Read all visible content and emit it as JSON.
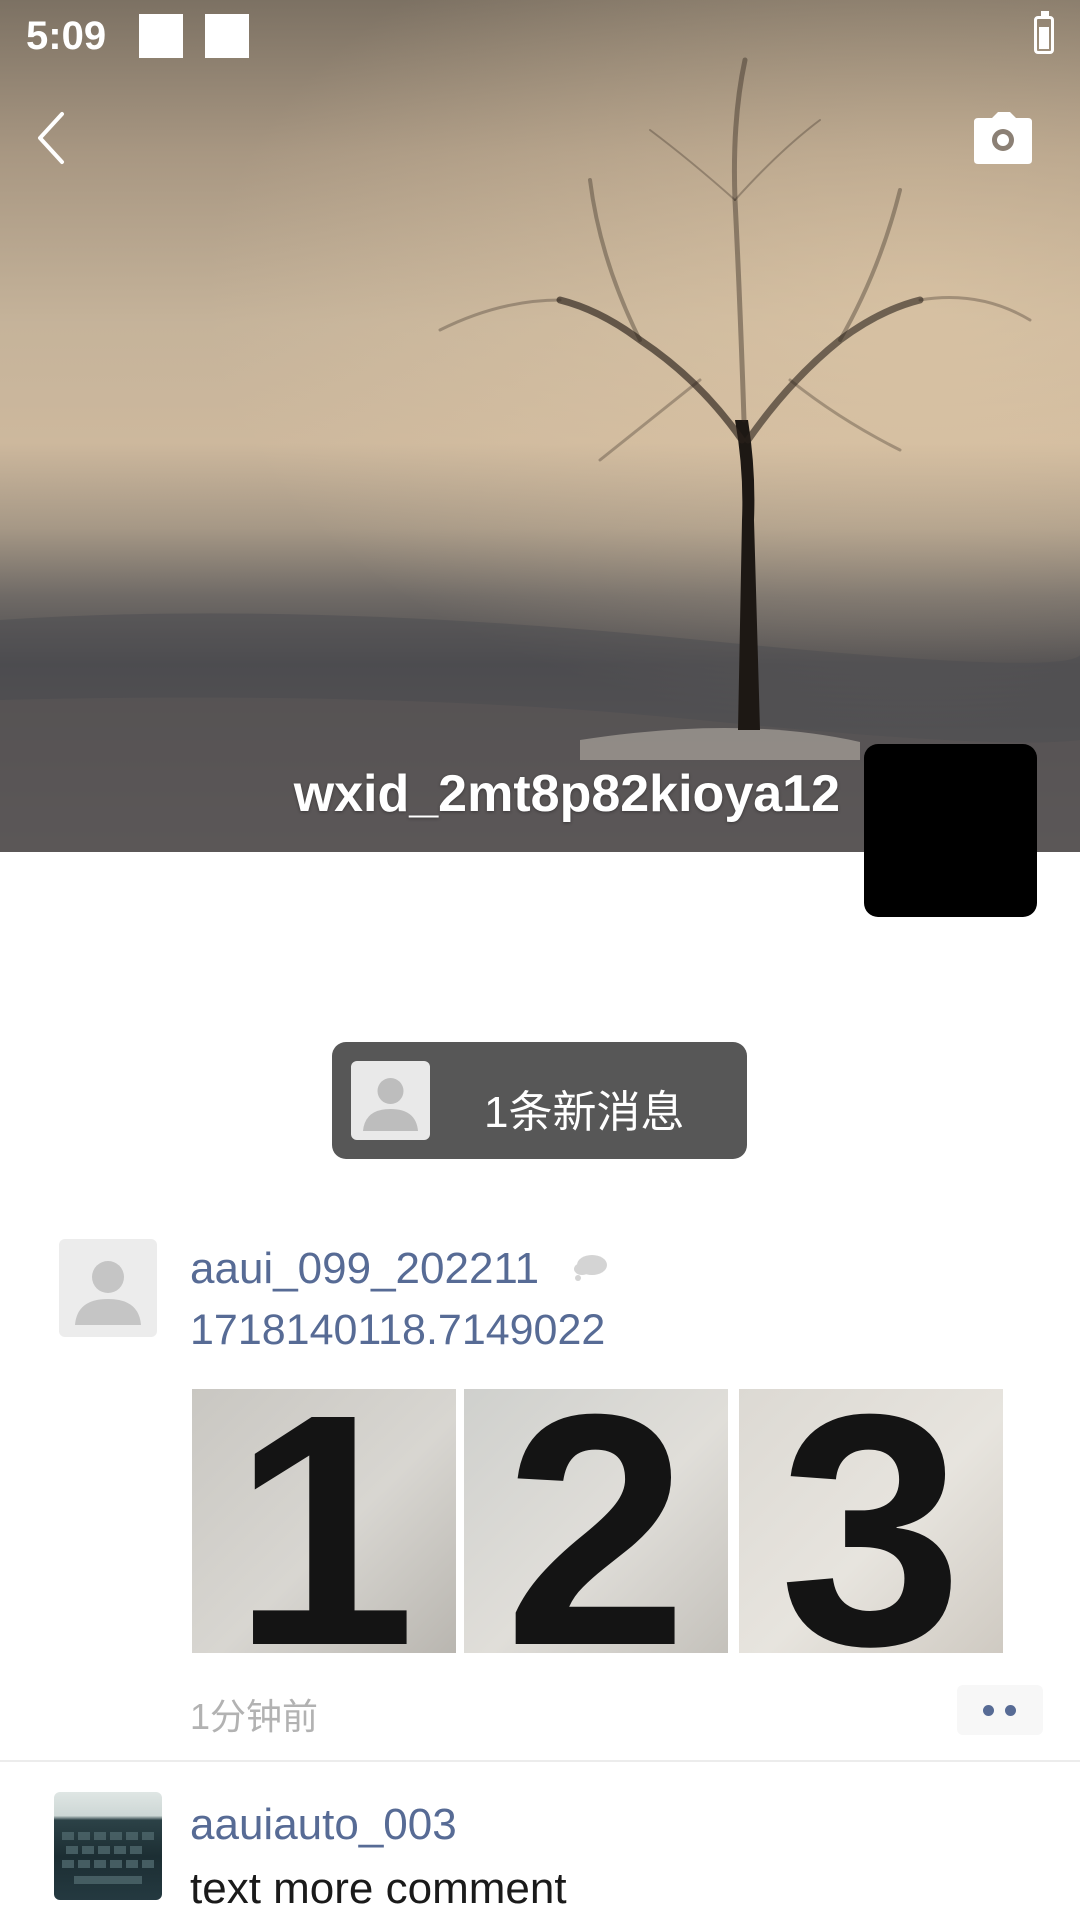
{
  "status_bar": {
    "time": "5:09",
    "icons": [
      "notification-square-icon",
      "notification-square-icon",
      "battery-icon"
    ]
  },
  "header": {
    "back_icon": "back-chevron-icon",
    "camera_icon": "camera-icon",
    "username": "wxid_2mt8p82kioya12",
    "avatar_color": "#000000"
  },
  "new_message": {
    "label": "1条新消息",
    "icon": "default-avatar-icon",
    "background": "#575757"
  },
  "post": {
    "user": "aaui_099_202211",
    "privacy_icon": "cloud-icon",
    "text": "1718140118.7149022",
    "photos": [
      "1",
      "2",
      "3"
    ],
    "time": "1分钟前",
    "more_icon": "more-dots-icon"
  },
  "comment": {
    "user": "aauiauto_003",
    "text": "text more comment"
  },
  "colors": {
    "link": "#576b95",
    "time": "#b2b2b2",
    "text": "#1a1a1a"
  }
}
